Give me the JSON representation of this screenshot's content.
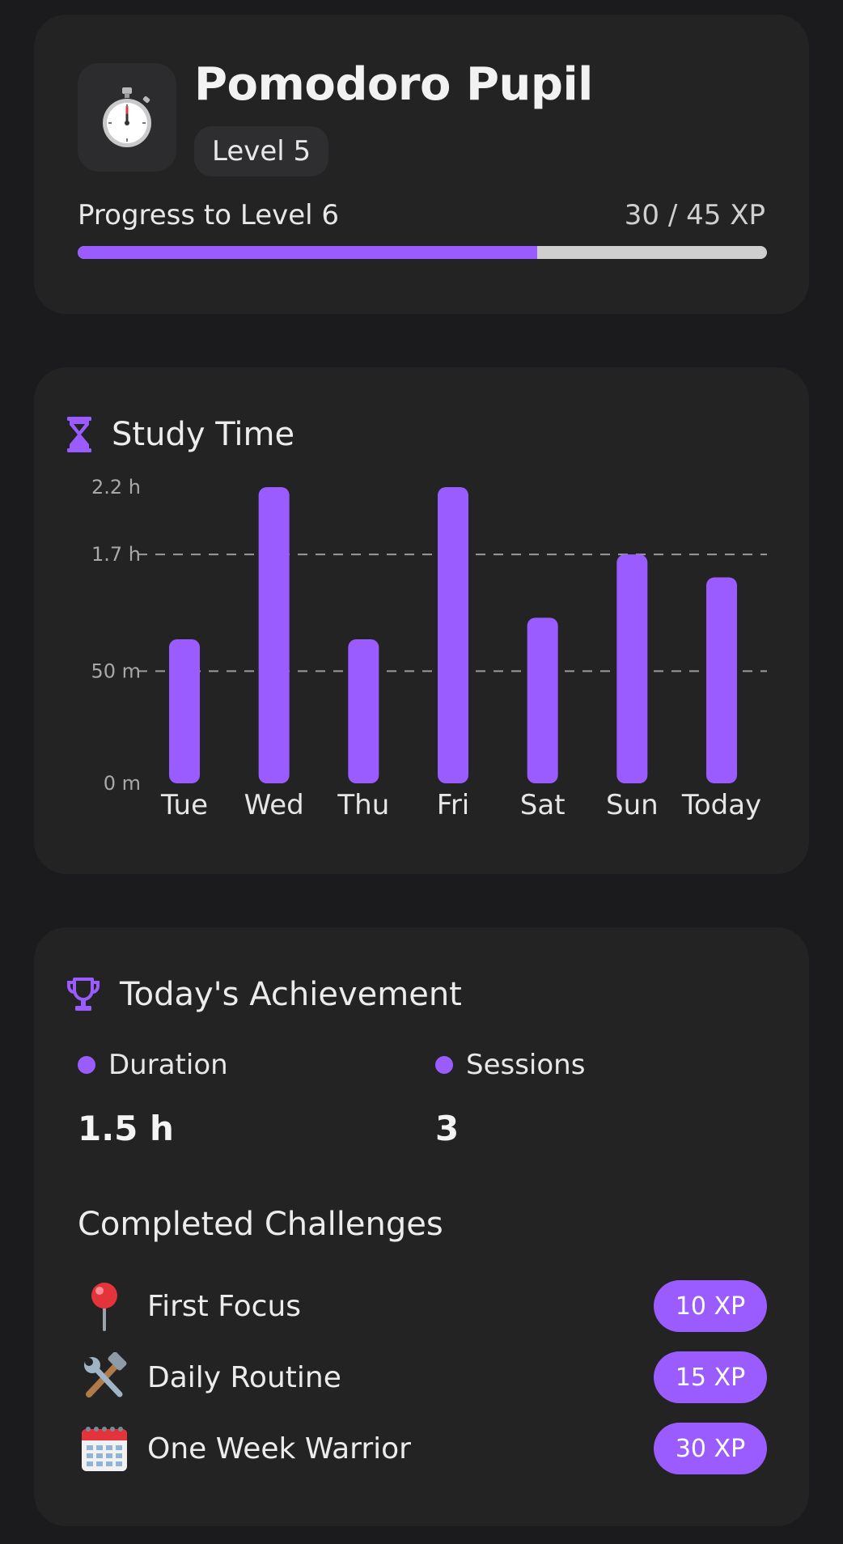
{
  "profile": {
    "name": "Pomodoro Pupil",
    "level_label": "Level 5",
    "progress_label": "Progress to Level 6",
    "xp_text": "30 / 45 XP",
    "progress_fraction": 0.667,
    "icon": "stopwatch-icon"
  },
  "study_time": {
    "title": "Study Time",
    "icon": "hourglass-icon"
  },
  "chart_data": {
    "type": "bar",
    "categories": [
      "Tue",
      "Wed",
      "Thu",
      "Fri",
      "Sat",
      "Sun",
      "Today"
    ],
    "values": [
      1.07,
      2.2,
      1.07,
      2.2,
      1.23,
      1.7,
      1.53
    ],
    "unit": "hours",
    "yticks": [
      {
        "value": 0,
        "label": "0 m"
      },
      {
        "value": 0.833,
        "label": "50 m"
      },
      {
        "value": 1.7,
        "label": "1.7 h"
      },
      {
        "value": 2.2,
        "label": "2.2 h"
      }
    ],
    "dashed_gridlines": [
      0.833,
      1.7
    ],
    "ylim": [
      0,
      2.2
    ],
    "bar_color": "#9b5cff"
  },
  "achievement": {
    "title": "Today's Achievement",
    "icon": "trophy-icon",
    "duration_label": "Duration",
    "duration_value": "1.5 h",
    "sessions_label": "Sessions",
    "sessions_value": "3",
    "challenges_title": "Completed Challenges",
    "challenges": [
      {
        "name": "First Focus",
        "xp": "10 XP",
        "icon": "pushpin-icon"
      },
      {
        "name": "Daily Routine",
        "xp": "15 XP",
        "icon": "hammer-wrench-icon"
      },
      {
        "name": "One Week Warrior",
        "xp": "30 XP",
        "icon": "calendar-icon"
      }
    ]
  },
  "colors": {
    "accent": "#9b5cff",
    "background": "#1b1b1d",
    "card": "#232324"
  }
}
